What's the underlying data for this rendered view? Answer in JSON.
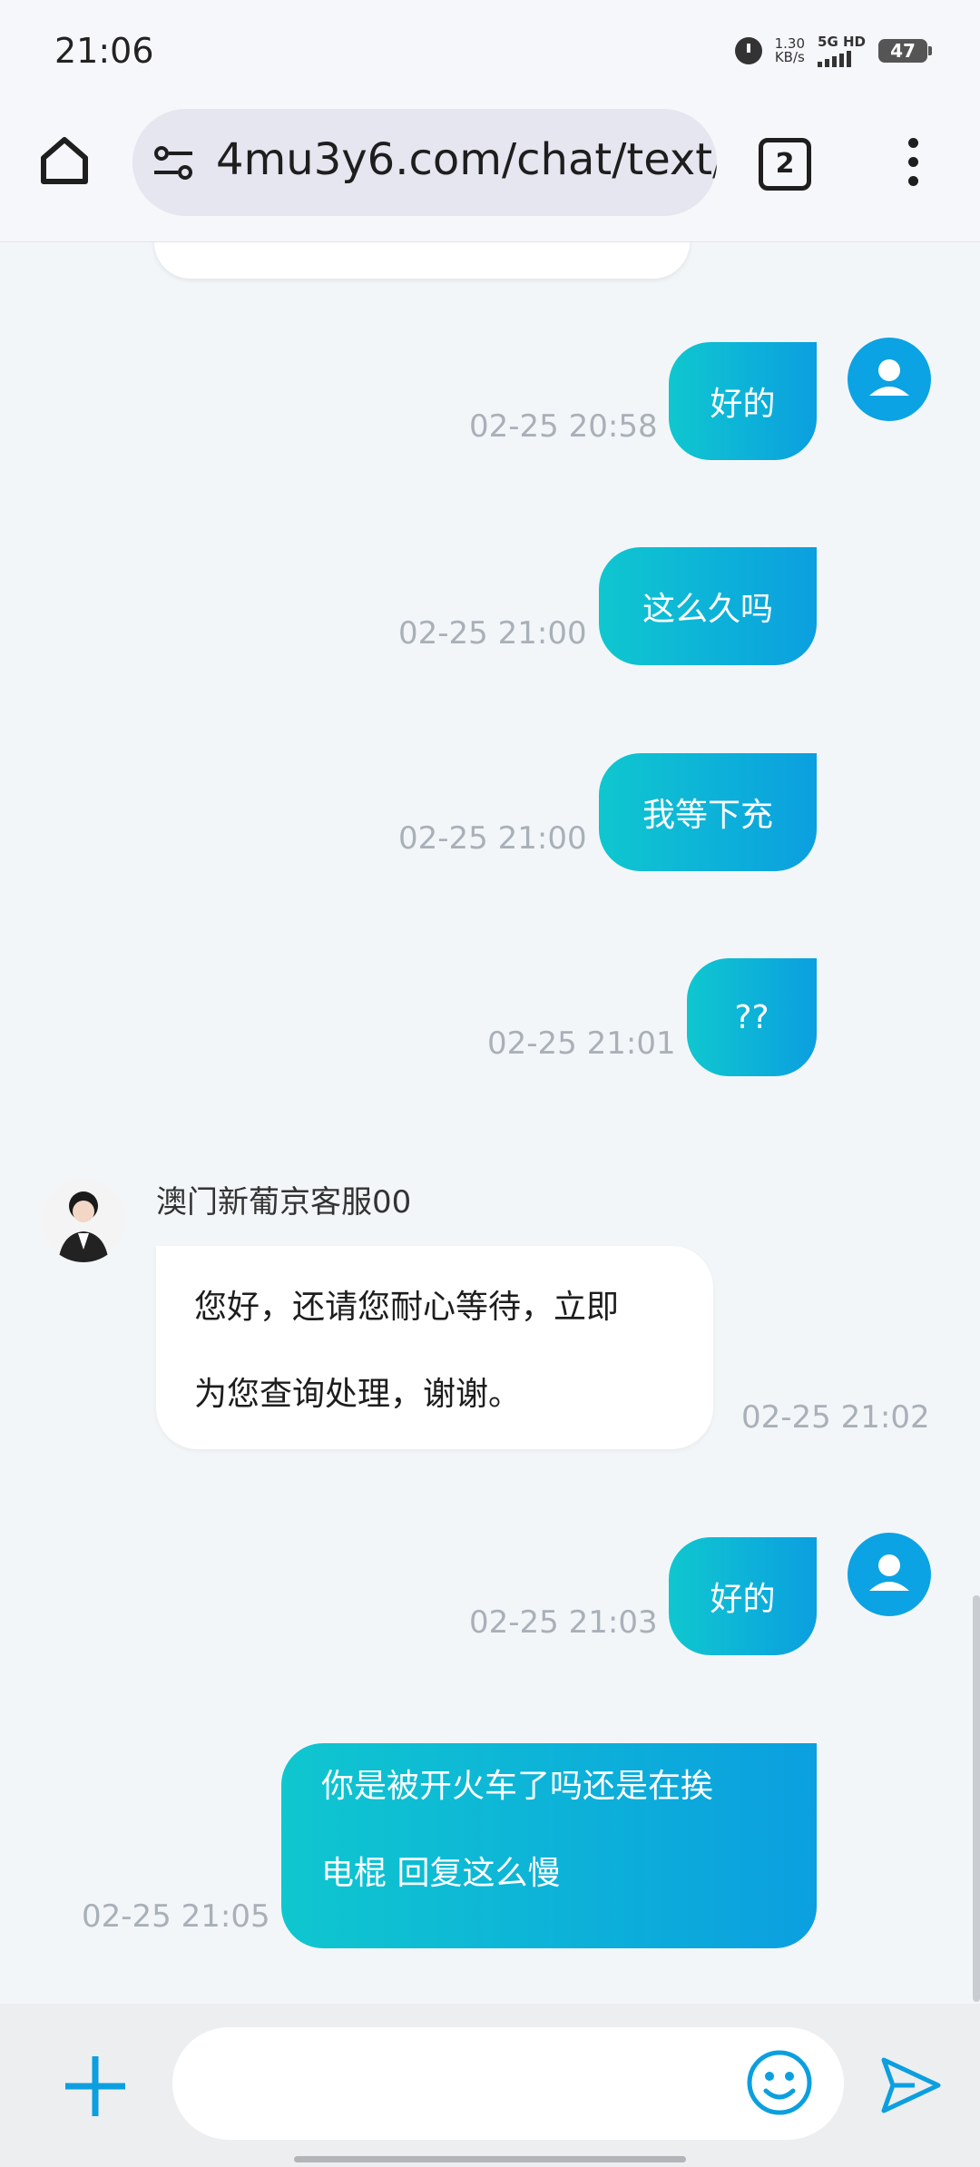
{
  "status_bar": {
    "time": "21:06",
    "net_speed_value": "1.30",
    "net_speed_unit": "KB/s",
    "net_type": "5G HD",
    "battery": "47"
  },
  "browser": {
    "url": "4mu3y6.com/chat/text/",
    "tab_count": "2"
  },
  "messages": [
    {
      "from": "user",
      "text": "好的",
      "time": "02-25 20:58"
    },
    {
      "from": "user",
      "text": "这么久吗",
      "time": "02-25 21:00"
    },
    {
      "from": "user",
      "text": "我等下充",
      "time": "02-25 21:00"
    },
    {
      "from": "user",
      "text": "??",
      "time": "02-25 21:01"
    },
    {
      "from": "agent",
      "name": "澳门新葡京客服00",
      "lines": [
        "您好，还请您耐心等待，立即",
        "为您查询处理，谢谢。"
      ],
      "time": "02-25 21:02"
    },
    {
      "from": "user",
      "text": "好的",
      "time": "02-25 21:03"
    },
    {
      "from": "user",
      "lines": [
        "你是被开火车了吗还是在挨",
        "电棍 回复这么慢"
      ],
      "time": "02-25 21:05"
    }
  ],
  "input": {
    "placeholder": ""
  },
  "icons": {
    "home": "home-icon",
    "site_settings": "tune-icon",
    "menu": "more-vert-icon",
    "add": "plus-icon",
    "emoji": "emoji-icon",
    "send": "send-icon"
  },
  "colors": {
    "accent": "#0ba3e3",
    "bubble_gradient_start": "#0fc7cf",
    "bubble_gradient_end": "#0b9fe0"
  }
}
